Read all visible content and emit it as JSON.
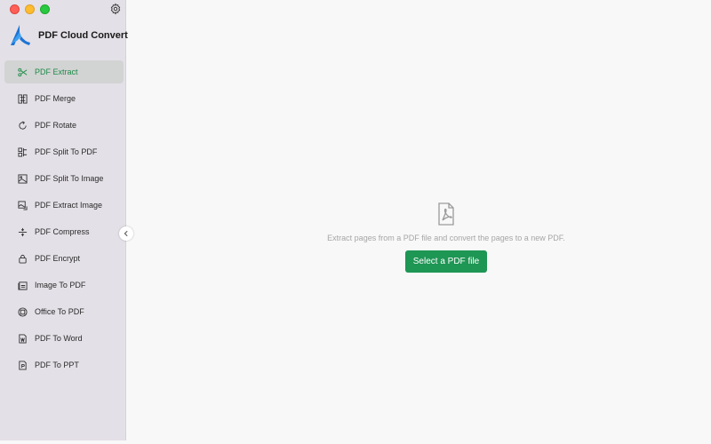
{
  "app": {
    "title": "PDF Cloud Convert",
    "accent_color": "#1e9654",
    "logo_icon": "pdf-cloud-convert-logo"
  },
  "window_controls": [
    "close",
    "minimize",
    "zoom"
  ],
  "sidebar": {
    "settings_icon": "gear-icon",
    "items": [
      {
        "label": "PDF Extract",
        "icon": "scissors-icon",
        "active": true
      },
      {
        "label": "PDF Merge",
        "icon": "merge-icon"
      },
      {
        "label": "PDF Rotate",
        "icon": "rotate-icon"
      },
      {
        "label": "PDF Split To PDF",
        "icon": "split-pdf-icon"
      },
      {
        "label": "PDF Split To Image",
        "icon": "split-image-icon"
      },
      {
        "label": "PDF Extract Image",
        "icon": "extract-image-icon"
      },
      {
        "label": "PDF Compress",
        "icon": "compress-icon"
      },
      {
        "label": "PDF Encrypt",
        "icon": "lock-icon"
      },
      {
        "label": "Image To PDF",
        "icon": "image-to-pdf-icon"
      },
      {
        "label": "Office To PDF",
        "icon": "office-icon"
      },
      {
        "label": "PDF To Word",
        "icon": "word-icon"
      },
      {
        "label": "PDF To PPT",
        "icon": "ppt-icon"
      }
    ],
    "collapse_icon": "chevron-left-icon"
  },
  "main": {
    "empty_icon": "pdf-file-icon",
    "description": "Extract pages from a PDF file and convert the pages to a new PDF.",
    "select_button": "Select a PDF file"
  }
}
